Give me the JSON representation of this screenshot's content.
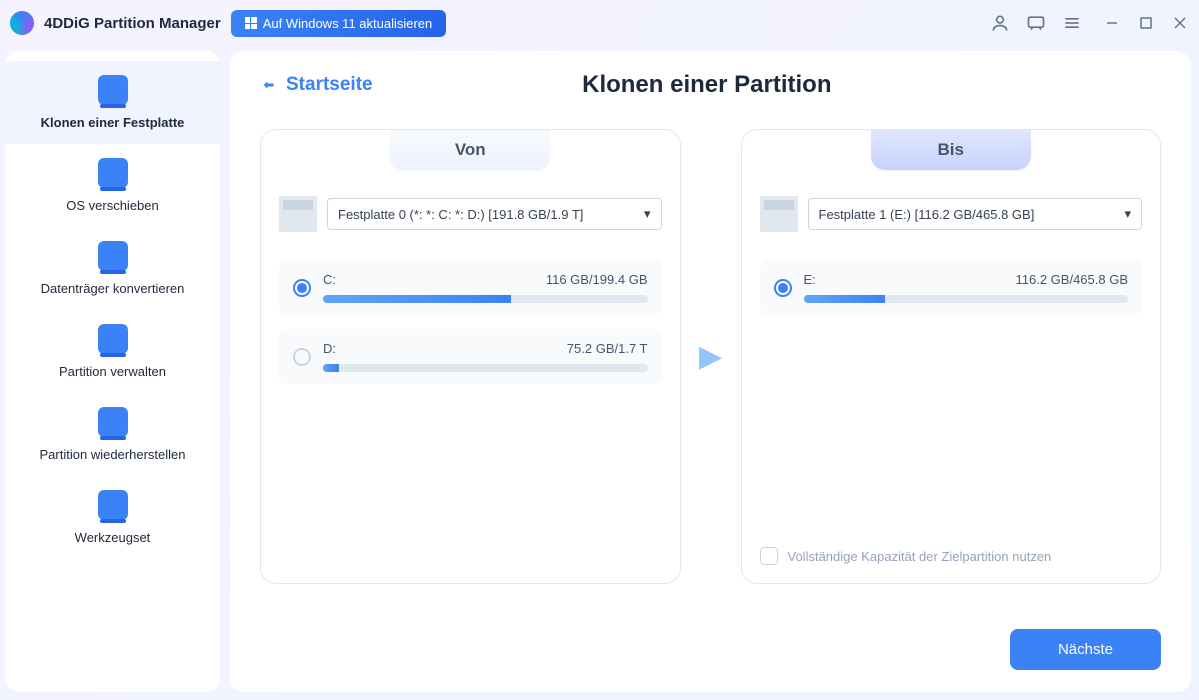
{
  "titleBar": {
    "appName": "4DDiG Partition Manager",
    "upgradeLabel": "Auf Windows 11 aktualisieren"
  },
  "sidebar": {
    "items": [
      "Klonen einer Festplatte",
      "OS verschieben",
      "Datenträger konvertieren",
      "Partition verwalten",
      "Partition wiederherstellen",
      "Werkzeugset"
    ]
  },
  "main": {
    "backLabel": "Startseite",
    "title": "Klonen einer Partition",
    "source": {
      "tabLabel": "Von",
      "diskSelect": "Festplatte 0 (*: *: C: *: D:) [191.8 GB/1.9 T]",
      "partitions": [
        {
          "drive": "C:",
          "usage": "116 GB/199.4 GB",
          "fillPct": 58,
          "selected": true
        },
        {
          "drive": "D:",
          "usage": "75.2 GB/1.7 T",
          "fillPct": 5,
          "selected": false
        }
      ]
    },
    "target": {
      "tabLabel": "Bis",
      "diskSelect": "Festplatte 1 (E:) [116.2 GB/465.8 GB]",
      "partitions": [
        {
          "drive": "E:",
          "usage": "116.2 GB/465.8 GB",
          "fillPct": 25,
          "selected": true
        }
      ],
      "checkboxLabel": "Vollständige Kapazität der Zielpartition nutzen"
    },
    "nextButton": "Nächste"
  }
}
